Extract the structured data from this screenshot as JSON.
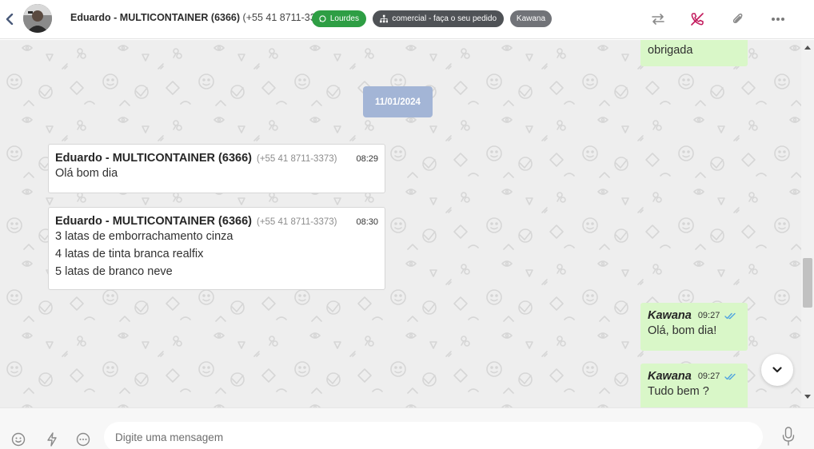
{
  "header": {
    "contact_name": "Eduardo - MULTICONTAINER (6366)",
    "contact_phone": "(+55 41 8711-3373)",
    "tags": [
      {
        "label": "Lourdes",
        "icon": "whatsapp-icon",
        "color": "#2e9e44"
      },
      {
        "label": "comercial - faça o seu pedido",
        "icon": "sitemap-icon",
        "color": "#4f5256"
      },
      {
        "label": "Kawana",
        "color": "#717378"
      }
    ],
    "actions": [
      "transfer-icon",
      "end-call-icon",
      "attach-icon",
      "more-icon"
    ]
  },
  "chat": {
    "partial_message": "obrigada",
    "date_separator": "11/01/2024",
    "incoming": [
      {
        "sender": "Eduardo - MULTICONTAINER (6366)",
        "phone": "(+55 41 8711-3373)",
        "time": "08:29",
        "lines": [
          "Olá bom dia"
        ]
      },
      {
        "sender": "Eduardo - MULTICONTAINER (6366)",
        "phone": "(+55 41 8711-3373)",
        "time": "08:30",
        "lines": [
          "3 latas de emborrachamento cinza",
          "4 latas de tinta branca realfix",
          "5 latas de branco neve"
        ]
      }
    ],
    "outgoing": [
      {
        "sender": "Kawana",
        "time": "09:27",
        "text": "Olá, bom dia!",
        "status": "read"
      },
      {
        "sender": "Kawana",
        "time": "09:27",
        "text": "Tudo bem ?",
        "status": "read"
      }
    ]
  },
  "composer": {
    "placeholder": "Digite uma mensagem",
    "value": ""
  },
  "colors": {
    "incoming_bubble": "#ffffff",
    "outgoing_bubble": "#d9f7c8",
    "date_pill": "#a3b5d6",
    "read_ticks": "#4fa3e0",
    "end_call": "#c2185b"
  }
}
